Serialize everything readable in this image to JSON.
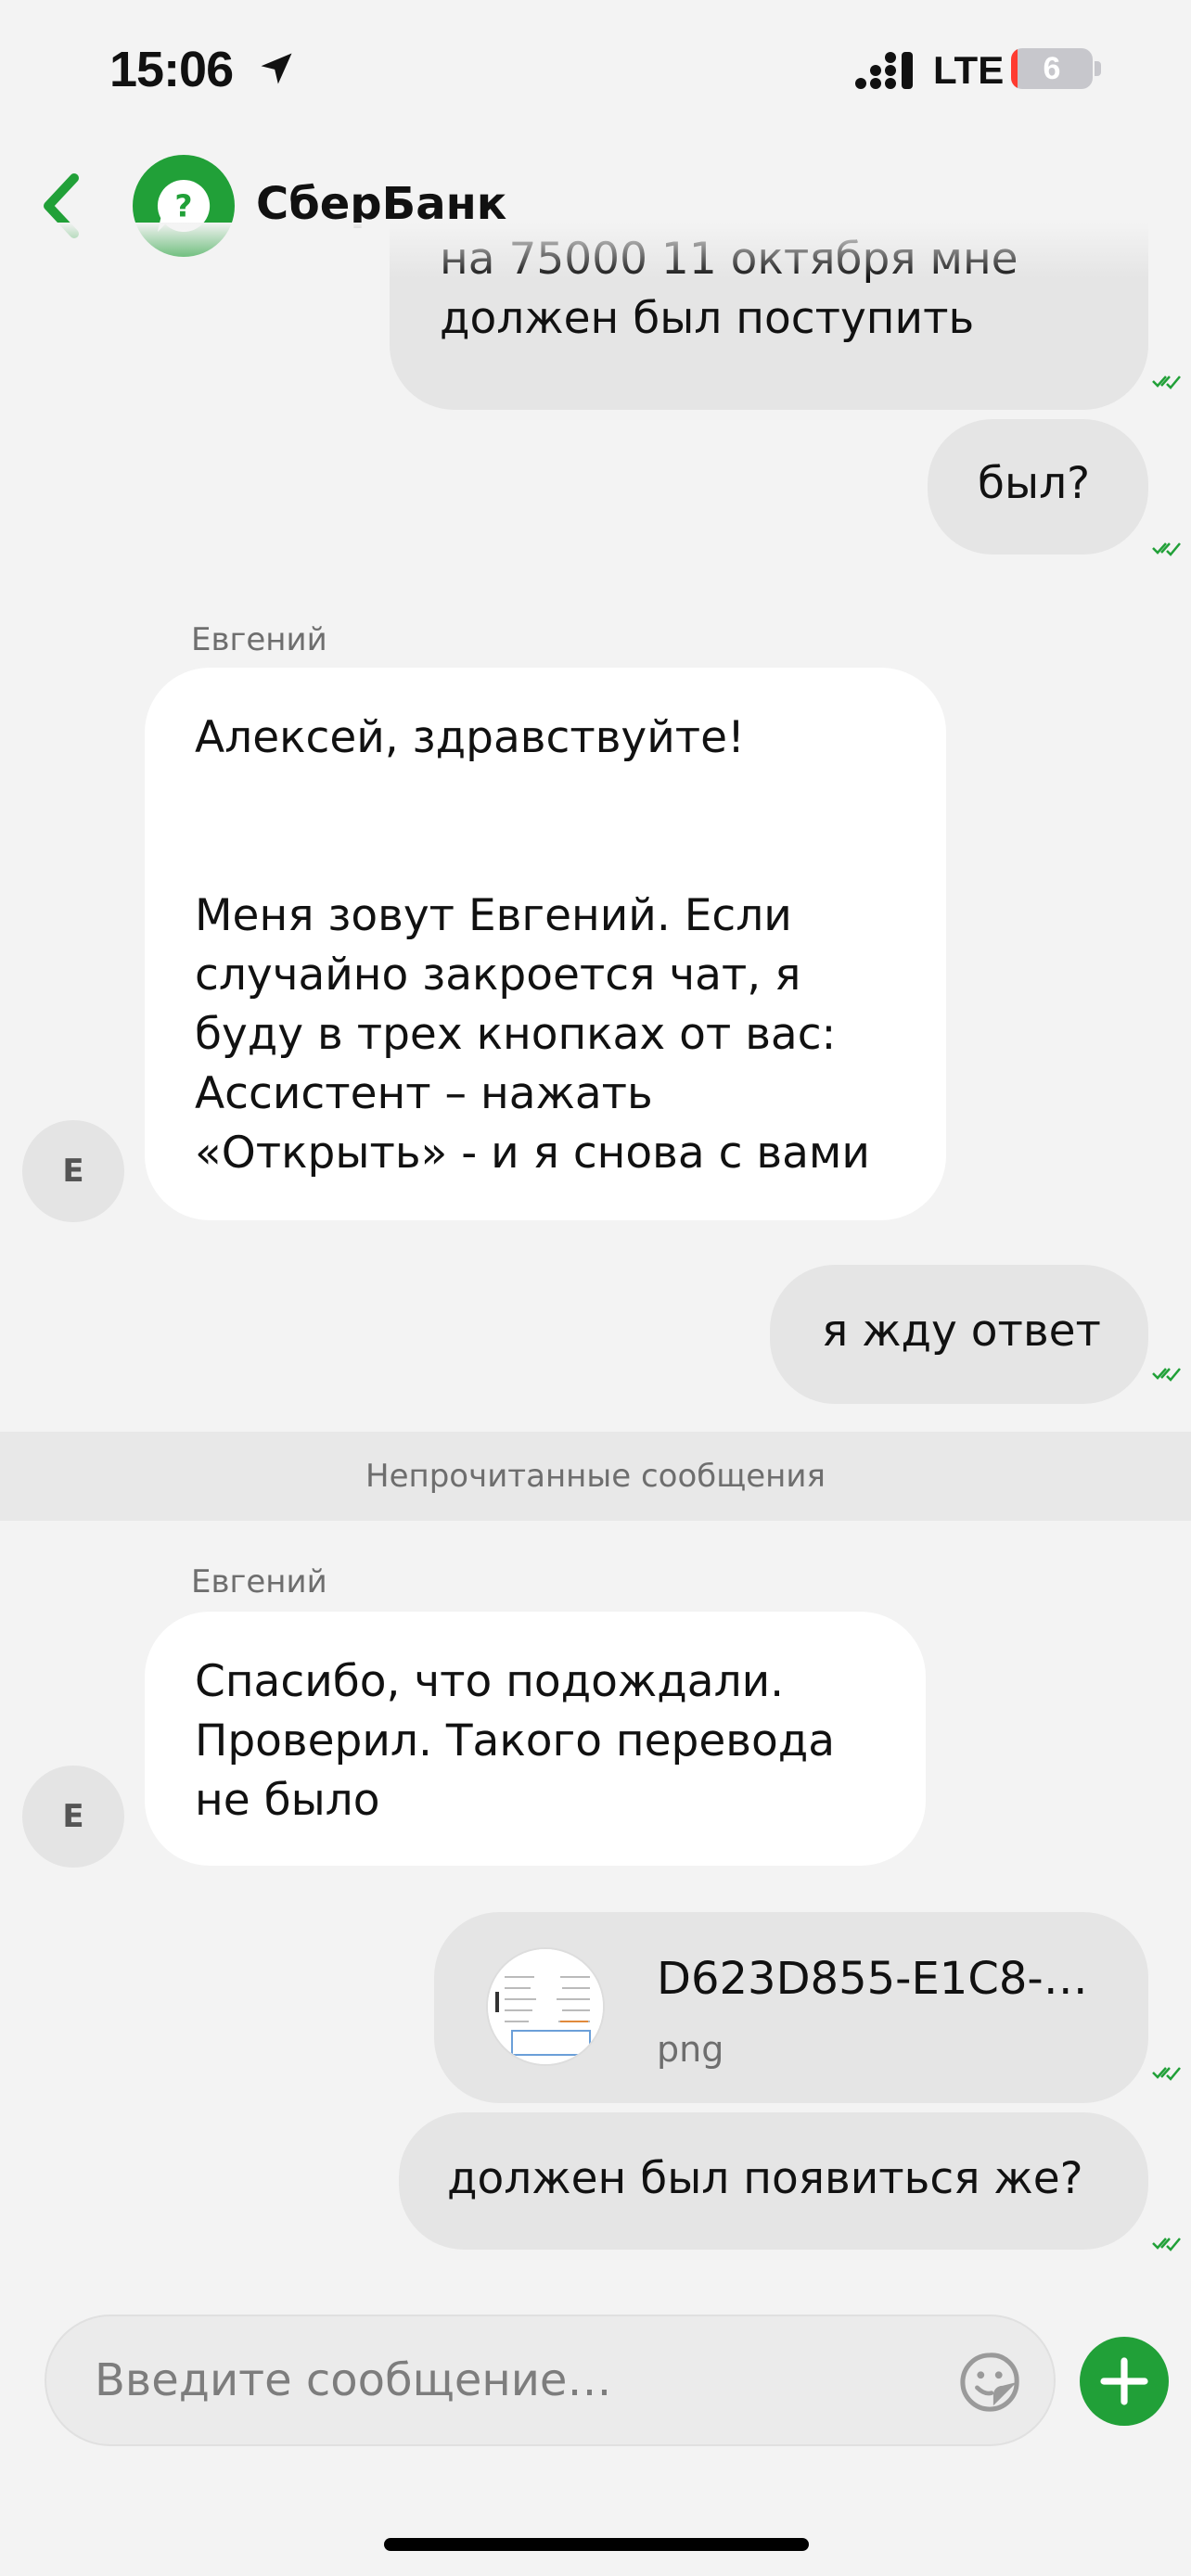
{
  "status_bar": {
    "time": "15:06",
    "network": "LTE",
    "battery_level": "6",
    "battery_fraction": 0.06,
    "icons": [
      "location-arrow-icon",
      "signal-icon"
    ]
  },
  "header": {
    "title": "СберБанк",
    "back_icon": "chevron-left-icon",
    "avatar_icon": "question-bubble-icon",
    "brand_color": "#21a038"
  },
  "messages": [
    {
      "direction": "out",
      "text": "на 75000 11 октября мне\nдолжен был поступить",
      "status": "read"
    },
    {
      "direction": "out",
      "text": "был?",
      "status": "read"
    },
    {
      "direction": "in",
      "sender": "Евгений",
      "avatar_initial": "Е",
      "text": "Алексей, здравствуйте!\n\n\nМеня зовут Евгений. Если\nслучайно закроется чат, я\nбуду в трех кнопках от вас:\nАссистент – нажать\n«Открыть» - и я снова с вами"
    },
    {
      "direction": "out",
      "text": "я жду ответ",
      "status": "read"
    },
    {
      "direction": "in",
      "sender": "Евгений",
      "avatar_initial": "Е",
      "text": "Спасибо, что подождали.\nПроверил. Такого перевода\nне было"
    },
    {
      "direction": "out",
      "type": "file",
      "file_name": "D623D855-E1C8-…",
      "file_ext": "png",
      "status": "read"
    },
    {
      "direction": "out",
      "text": "должен был появиться же?",
      "status": "read"
    }
  ],
  "unread_divider": "Непрочитанные сообщения",
  "composer": {
    "placeholder": "Введите сообщение…",
    "sticker_icon": "sticker-icon",
    "add_icon": "plus-icon"
  },
  "colors": {
    "background": "#f3f3f3",
    "outgoing_bubble": "#e5e5e5",
    "incoming_bubble": "#ffffff",
    "accent_green": "#21a038"
  }
}
